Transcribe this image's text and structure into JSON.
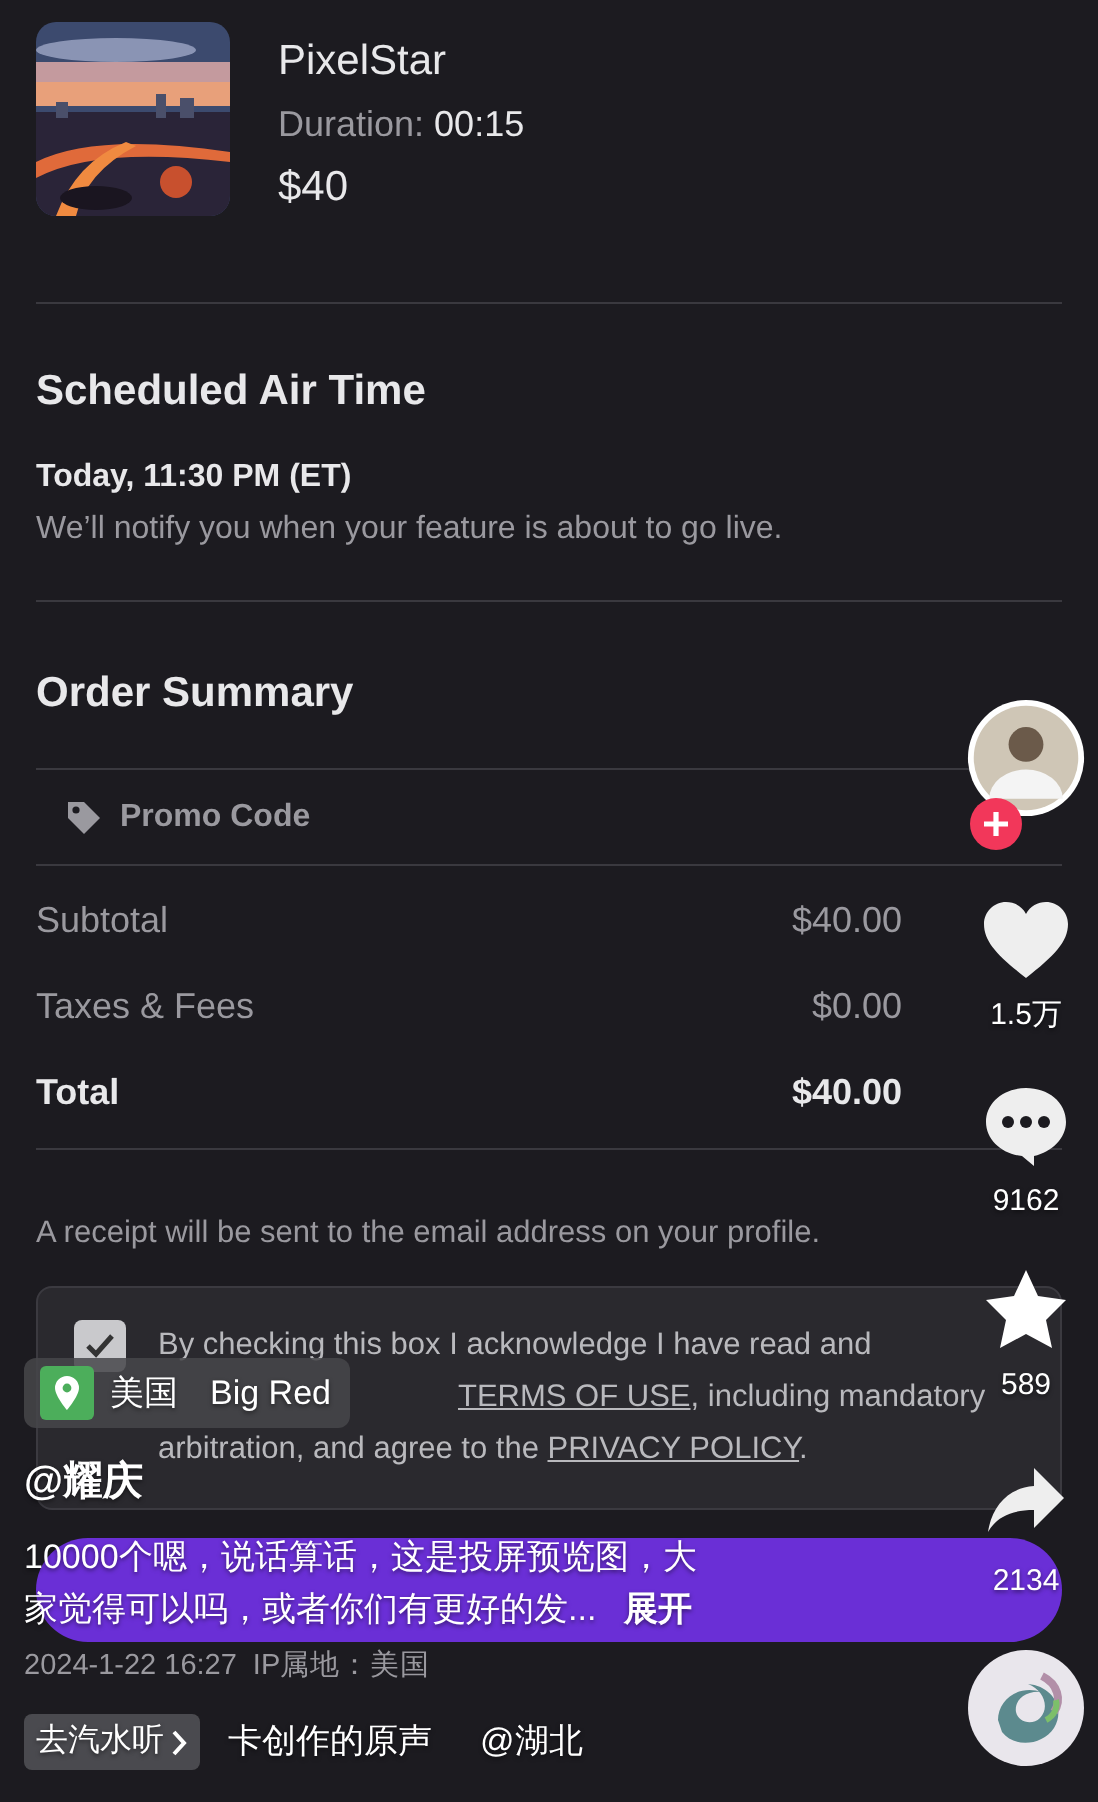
{
  "product": {
    "kind": "picture",
    "name": "PixelStar",
    "duration_label": "Duration:",
    "duration": "00:15",
    "price": "$40"
  },
  "schedule": {
    "title": "Scheduled Air Time",
    "when": "Today, 11:30 PM (ET)",
    "note": "We’ll notify you when your feature is about to go live."
  },
  "order_summary": {
    "title": "Order Summary",
    "promo_label": "Promo Code",
    "lines": [
      {
        "kind": "normal",
        "label": "Subtotal",
        "amount": "$40.00"
      },
      {
        "kind": "normal",
        "label": "Taxes & Fees",
        "amount": "$0.00"
      },
      {
        "kind": "total",
        "label": "Total",
        "amount": "$40.00"
      }
    ],
    "receipt_note": "A receipt will be sent to the email address on your profile."
  },
  "consent": {
    "checked": true,
    "line_1": "By checking this box I acknowledge I have read and",
    "terms_link": "TERMS OF USE",
    "after_terms": ", including mandatory",
    "line_3": "arbitration, and agree to the",
    "privacy_link": "PRIVACY POLICY",
    "end": "."
  },
  "video_overlay": {
    "location_country": "美国",
    "location_place": "Big Red",
    "author": "@耀庆",
    "caption_lines": [
      "10000个嗯，说话算话，这是投屏预览图，大",
      "家觉得可以吗，或者你们有更好的发..."
    ],
    "expand": "展开",
    "date": "2024-1-22 16:27",
    "ip_label": "IP属地：美国",
    "music_button": "去汽水听",
    "music_text": "卡创作的原声",
    "music_author": "@湖北"
  },
  "rail": {
    "liked": false,
    "likes": "1.5万",
    "comments": "9162",
    "favorited": false,
    "favorites": "589",
    "shares": "2134"
  }
}
